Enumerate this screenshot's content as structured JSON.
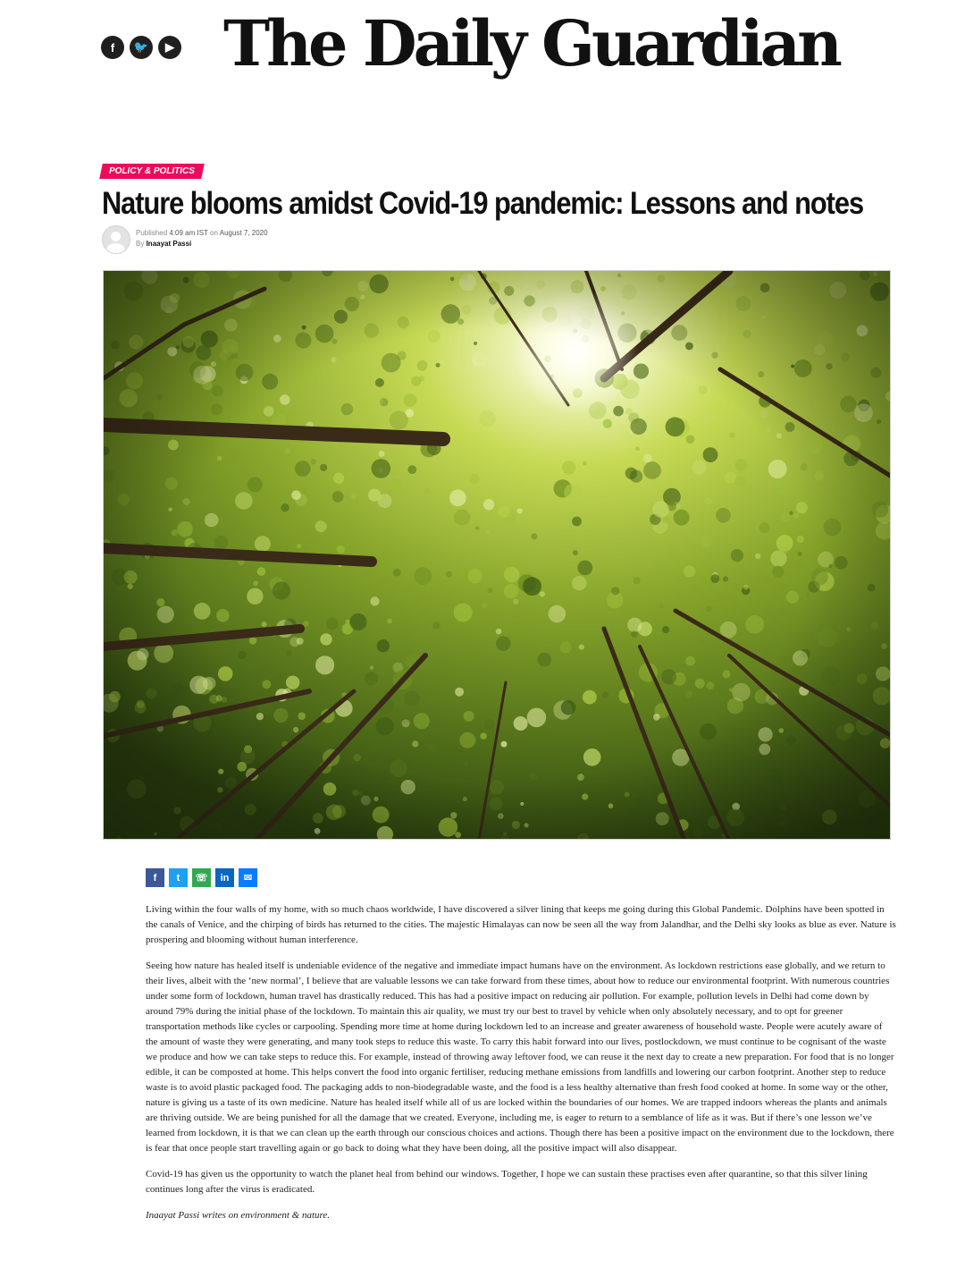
{
  "header": {
    "masthead": "The Daily Guardian",
    "social": [
      {
        "icon": "facebook-icon",
        "glyph": "f"
      },
      {
        "icon": "twitter-icon",
        "glyph": "🐦"
      },
      {
        "icon": "youtube-icon",
        "glyph": "▶"
      }
    ]
  },
  "article": {
    "category": "POLICY & POLITICS",
    "title": "Nature blooms amidst Covid-19 pandemic: Lessons and notes",
    "meta": {
      "published_label": "Published",
      "time": "4:09 am IST",
      "on_label": "on",
      "date": "August 7, 2020",
      "by_label": "By",
      "author": "Inaayat Passi"
    },
    "share": [
      {
        "icon": "facebook-share-icon",
        "glyph": "f"
      },
      {
        "icon": "twitter-share-icon",
        "glyph": "t"
      },
      {
        "icon": "whatsapp-share-icon",
        "glyph": "☏"
      },
      {
        "icon": "linkedin-share-icon",
        "glyph": "in"
      },
      {
        "icon": "messenger-share-icon",
        "glyph": "✉"
      }
    ],
    "paragraphs": [
      "Living within the four walls of my home, with so much chaos worldwide, I have discovered a silver lining that keeps me going during this Global Pandemic. Dolphins have been spotted in the canals of Venice, and the chirping of birds has returned to the cities. The majestic Himalayas can now be seen all the way from Jalandhar, and the Delhi sky looks as blue as ever. Nature is prospering and blooming without human interference.",
      "Seeing how nature has healed itself is undeniable evidence of the negative and immediate impact humans have on the environment. As lockdown restrictions ease globally, and we return to their lives, albeit with the ‘new normal’, I believe that are valuable lessons we can take forward from these times, about how to reduce our environmental footprint. With numerous countries under some form of lockdown, human travel has drastically reduced. This has had a positive impact on reducing air pollution. For example, pollution levels in Delhi had come down by around 79% during the initial phase of the lockdown. To maintain this air quality, we must try our best to travel by vehicle when only absolutely necessary, and to opt for greener transportation methods like cycles or carpooling. Spending more time at home during lockdown led to an increase and greater awareness of household waste. People were acutely aware of the amount of waste they were generating, and many took steps to reduce this waste. To carry this habit forward into our lives, postlockdown, we must continue to be cognisant of the waste we produce and how we can take steps to reduce this. For example, instead of throwing away leftover food, we can reuse it the next day to create a new preparation. For food that is no longer edible, it can be composted at home. This helps convert the food into organic fertiliser, reducing methane emissions from landfills and lowering our carbon footprint. Another step to reduce waste is to avoid plastic packaged food. The packaging adds to non-biodegradable waste, and the food is a less healthy alternative than fresh food cooked at home. In some way or the other, nature is giving us a taste of its own medicine. Nature has healed itself while all of us are locked within the boundaries of our homes. We are trapped indoors whereas the plants and animals are thriving outside. We are being punished for all the damage that we created. Everyone, including me, is eager to return to a semblance of life as it was. But if there’s one lesson we’ve learned from lockdown, it is that we can clean up the earth through our conscious choices and actions. Though there has been a positive impact on the environment due to the lockdown, there is fear that once people start travelling again or go back to doing what they have been doing, all the positive impact will also disappear.",
      " Covid-19 has given us the opportunity to watch the planet heal from behind our windows. Together, I hope we can sustain these practises even after quarantine, so that this silver lining continues long after the virus is eradicated."
    ],
    "byline": "Inaayat Passi writes on environment & nature."
  },
  "colors": {
    "category_badge": "#ec0a5b",
    "masthead": "#111111",
    "canopy_light": "#c8dc55",
    "canopy_dark": "#2e4a12"
  }
}
